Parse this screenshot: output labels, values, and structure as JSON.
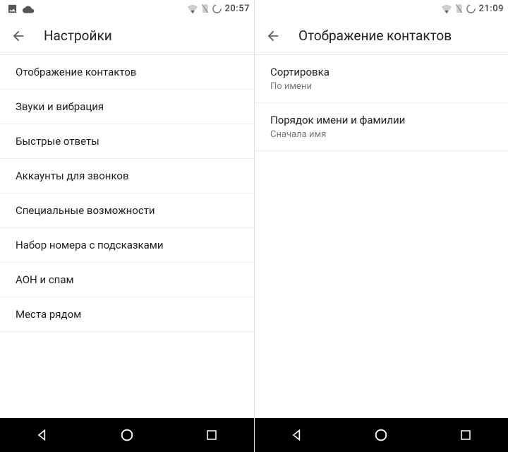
{
  "left": {
    "status": {
      "time": "20:57"
    },
    "appbar": {
      "title": "Настройки"
    },
    "items": [
      {
        "label": "Отображение контактов"
      },
      {
        "label": "Звуки и вибрация"
      },
      {
        "label": "Быстрые ответы"
      },
      {
        "label": "Аккаунты для звонков"
      },
      {
        "label": "Специальные возможности"
      },
      {
        "label": "Набор номера с подсказками"
      },
      {
        "label": "АОН и спам"
      },
      {
        "label": "Места рядом"
      }
    ]
  },
  "right": {
    "status": {
      "time": "21:09"
    },
    "appbar": {
      "title": "Отображение контактов"
    },
    "items": [
      {
        "label": "Сортировка",
        "value": "По имени"
      },
      {
        "label": "Порядок имени и фамилии",
        "value": "Сначала имя"
      }
    ]
  }
}
